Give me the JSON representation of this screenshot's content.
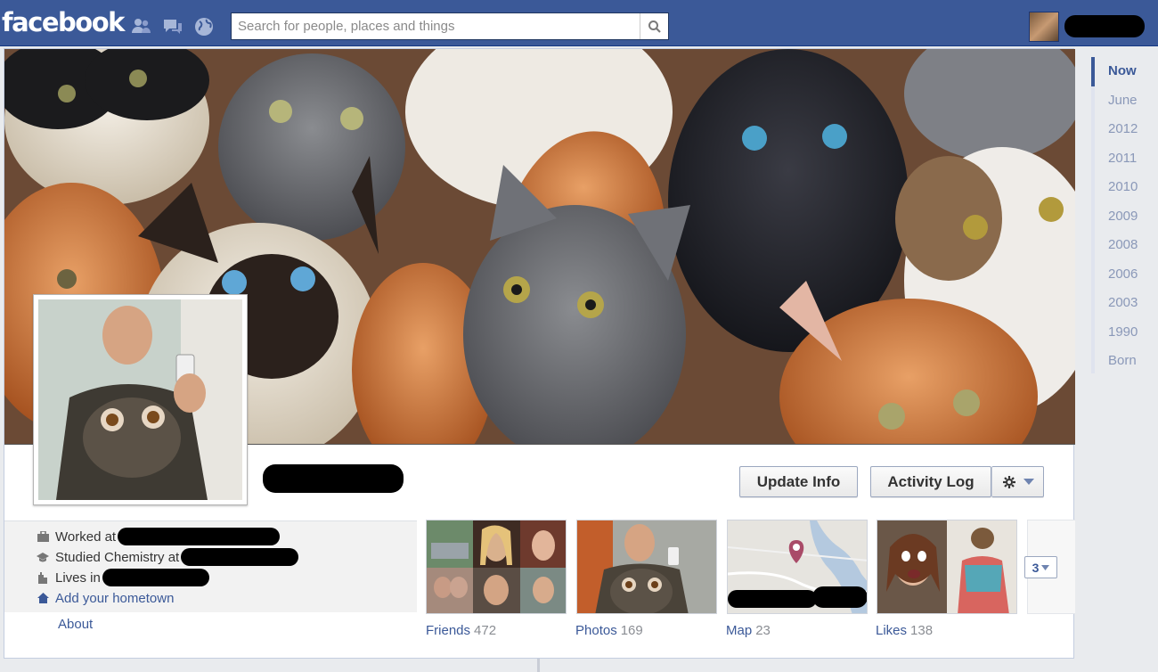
{
  "header": {
    "logo": "facebook",
    "search_placeholder": "Search for people, places and things",
    "icons": [
      "friend-requests-icon",
      "messages-icon",
      "notifications-globe-icon",
      "search-icon"
    ]
  },
  "profile": {
    "update_info_label": "Update Info",
    "activity_log_label": "Activity Log"
  },
  "intro": {
    "worked_at": "Worked at",
    "studied": "Studied Chemistry at",
    "lives_in": "Lives in",
    "add_hometown": "Add your hometown",
    "about": "About"
  },
  "sections": [
    {
      "label": "Friends",
      "count": "472"
    },
    {
      "label": "Photos",
      "count": "169"
    },
    {
      "label": "Map",
      "count": "23"
    },
    {
      "label": "Likes",
      "count": "138"
    }
  ],
  "more_button": "3",
  "timeline": [
    "Now",
    "June",
    "2012",
    "2011",
    "2010",
    "2009",
    "2008",
    "2006",
    "2003",
    "1990",
    "Born"
  ],
  "colors": {
    "brand": "#3b5998",
    "link": "#3b5998",
    "muted": "#8a98b8"
  }
}
